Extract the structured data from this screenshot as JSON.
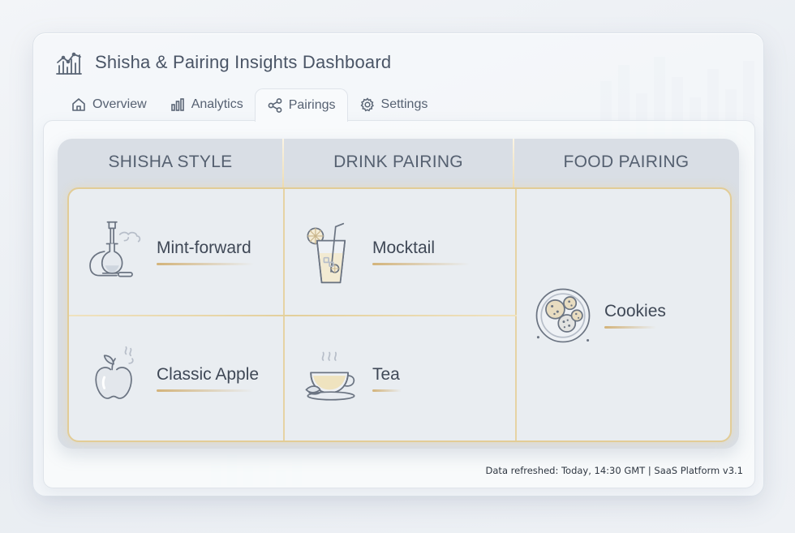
{
  "header": {
    "title": "Shisha & Pairing Insights Dashboard",
    "logo_icon": "chart-logo-icon"
  },
  "tabs": [
    {
      "label": "Overview",
      "icon": "home-icon",
      "active": false
    },
    {
      "label": "Analytics",
      "icon": "bar-chart-icon",
      "active": false
    },
    {
      "label": "Pairings",
      "icon": "share-nodes-icon",
      "active": true
    },
    {
      "label": "Settings",
      "icon": "gear-icon",
      "active": false
    }
  ],
  "table": {
    "columns": [
      "SHISHA STYLE",
      "DRINK PAIRING",
      "FOOD PAIRING"
    ],
    "shisha": [
      {
        "label": "Mint-forward",
        "icon": "hookah-icon"
      },
      {
        "label": "Classic Apple",
        "icon": "apple-icon"
      }
    ],
    "drinks": [
      {
        "label": "Mocktail",
        "icon": "mocktail-glass-icon"
      },
      {
        "label": "Tea",
        "icon": "tea-cup-icon"
      }
    ],
    "food": [
      {
        "label": "Cookies",
        "icon": "cookies-plate-icon"
      }
    ]
  },
  "footer": {
    "status": "Data refreshed: Today, 14:30 GMT  |  SaaS Platform v3.1"
  },
  "colors": {
    "accent_gold": "#d3b37a",
    "header_bg": "#d9dee5",
    "text": "#3f4856"
  }
}
